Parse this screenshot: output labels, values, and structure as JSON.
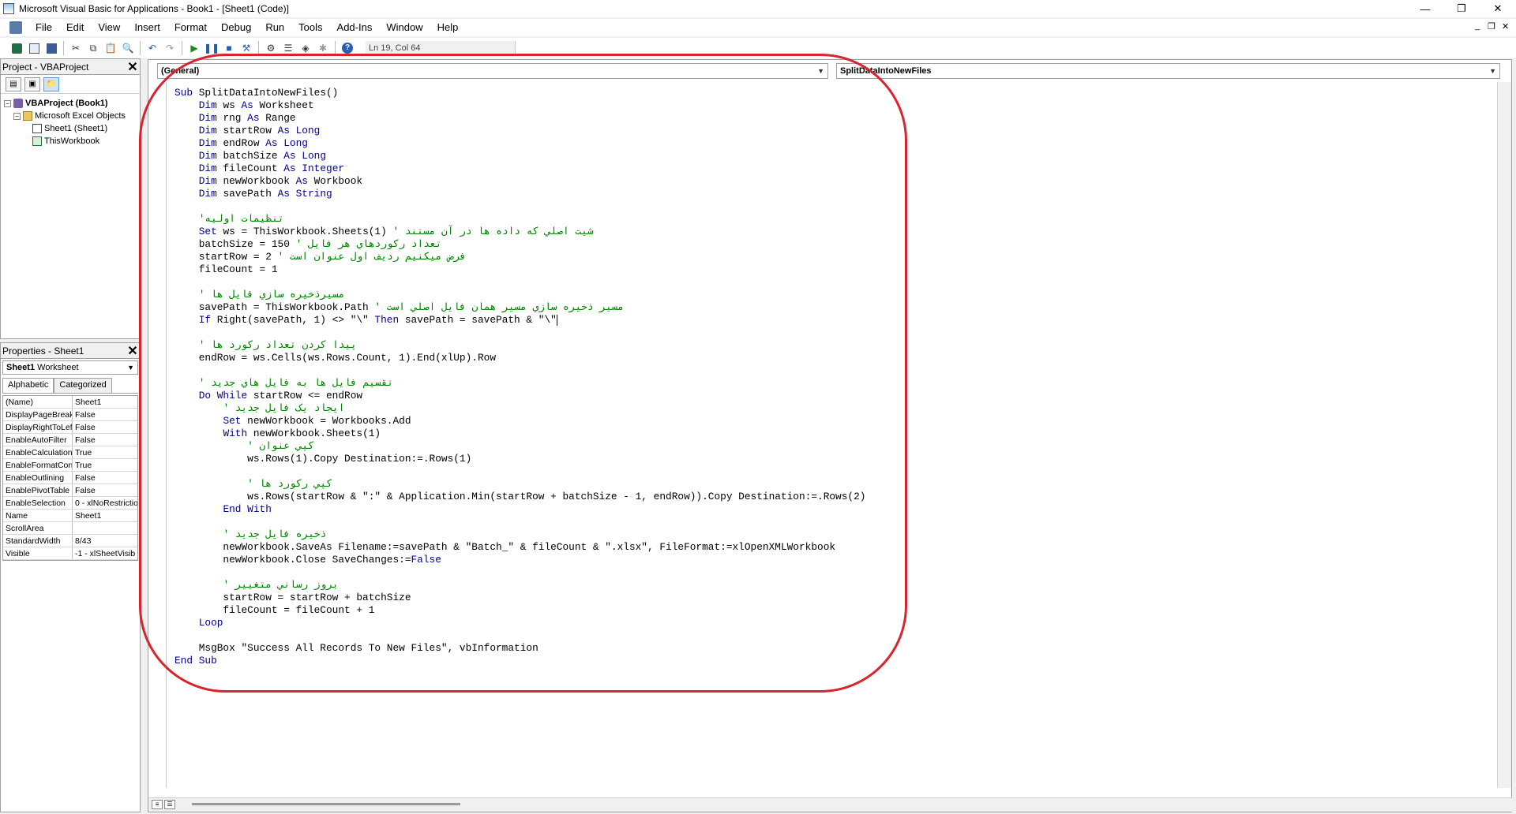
{
  "window": {
    "title": "Microsoft Visual Basic for Applications - Book1 - [Sheet1 (Code)]",
    "controls": {
      "minimize": "—",
      "restore": "❐",
      "close": "✕"
    }
  },
  "menubar": {
    "items": [
      "File",
      "Edit",
      "View",
      "Insert",
      "Format",
      "Debug",
      "Run",
      "Tools",
      "Add-Ins",
      "Window",
      "Help"
    ],
    "mdi_controls": {
      "minimize": "_",
      "restore": "❐",
      "close": "✕"
    }
  },
  "toolbar": {
    "position": "Ln 19, Col 64",
    "icons": [
      "excel-icon",
      "insert-module-icon",
      "save-icon",
      "cut-icon",
      "copy-icon",
      "paste-icon",
      "find-icon",
      "undo-icon",
      "redo-icon",
      "run-icon",
      "break-icon",
      "reset-icon",
      "design-mode-icon",
      "project-explorer-icon",
      "properties-icon",
      "object-browser-icon",
      "toolbox-icon",
      "help-icon"
    ]
  },
  "project_panel": {
    "title": "Project - VBAProject",
    "close": "✕",
    "tree": [
      {
        "label": "VBAProject (Book1)",
        "bold": true,
        "level": 0,
        "icon": "vbaproject-icon"
      },
      {
        "label": "Microsoft Excel Objects",
        "bold": false,
        "level": 1,
        "icon": "folder-icon"
      },
      {
        "label": "Sheet1 (Sheet1)",
        "bold": false,
        "level": 2,
        "icon": "sheet-icon"
      },
      {
        "label": "ThisWorkbook",
        "bold": false,
        "level": 2,
        "icon": "workbook-icon"
      }
    ]
  },
  "properties_panel": {
    "title": "Properties - Sheet1",
    "close": "✕",
    "object_name": "Sheet1",
    "object_type": "Worksheet",
    "tabs": [
      "Alphabetic",
      "Categorized"
    ],
    "rows": [
      {
        "name": "(Name)",
        "value": "Sheet1"
      },
      {
        "name": "DisplayPageBreak",
        "value": "False"
      },
      {
        "name": "DisplayRightToLef",
        "value": "False"
      },
      {
        "name": "EnableAutoFilter",
        "value": "False"
      },
      {
        "name": "EnableCalculation",
        "value": "True"
      },
      {
        "name": "EnableFormatCon",
        "value": "True"
      },
      {
        "name": "EnableOutlining",
        "value": "False"
      },
      {
        "name": "EnablePivotTable",
        "value": "False"
      },
      {
        "name": "EnableSelection",
        "value": "0 - xlNoRestrictio"
      },
      {
        "name": "Name",
        "value": "Sheet1"
      },
      {
        "name": "ScrollArea",
        "value": ""
      },
      {
        "name": "StandardWidth",
        "value": "8/43"
      },
      {
        "name": "Visible",
        "value": "-1 - xlSheetVisib"
      }
    ]
  },
  "code_window": {
    "object_combo": "(General)",
    "procedure_combo": "SplitDataIntoNewFiles",
    "lines": [
      "Sub SplitDataIntoNewFiles()",
      "    Dim ws As Worksheet",
      "    Dim rng As Range",
      "    Dim startRow As Long",
      "    Dim endRow As Long",
      "    Dim batchSize As Long",
      "    Dim fileCount As Integer",
      "    Dim newWorkbook As Workbook",
      "    Dim savePath As String",
      "",
      "    'تنظیمات اولیه",
      "    Set ws = ThisWorkbook.Sheets(1) ' شیت اصلي که داده ها در آن مستند",
      "    batchSize = 150 ' تعداد رکوردهاي هر فايل",
      "    startRow = 2 ' فرض ميکنيم رديف اول عنوان است",
      "    fileCount = 1",
      "",
      "    ' مسيرذخيره سازي فايل ها",
      "    savePath = ThisWorkbook.Path ' مسير ذخيره سازي مسير همان فايل اصلي است",
      "    If Right(savePath, 1) <> \"\\\" Then savePath = savePath & \"\\\"",
      "",
      "    ' پيدا کردن تعداد رکورد ها",
      "    endRow = ws.Cells(ws.Rows.Count, 1).End(xlUp).Row",
      "",
      "    ' تقسيم فايل ها به فايل هاي جديد",
      "    Do While startRow <= endRow",
      "        ' ايجاد يک فايل جديد",
      "        Set newWorkbook = Workbooks.Add",
      "        With newWorkbook.Sheets(1)",
      "            ' کپي عنوان",
      "            ws.Rows(1).Copy Destination:=.Rows(1)",
      "",
      "            ' کپي رکورد ها",
      "            ws.Rows(startRow & \":\" & Application.Min(startRow + batchSize - 1, endRow)).Copy Destination:=.Rows(2)",
      "        End With",
      "",
      "        ' ذخيره فايل جديد",
      "        newWorkbook.SaveAs Filename:=savePath & \"Batch_\" & fileCount & \".xlsx\", FileFormat:=xlOpenXMLWorkbook",
      "        newWorkbook.Close SaveChanges:=False",
      "",
      "        ' بروز رساني متغيير",
      "        startRow = startRow + batchSize",
      "        fileCount = fileCount + 1",
      "    Loop",
      "",
      "    MsgBox \"Success All Records To New Files\", vbInformation",
      "End Sub"
    ],
    "caret_line": 18
  },
  "colors": {
    "keyword": "#00008b",
    "comment": "#008000",
    "highlight": "#d9232d"
  }
}
